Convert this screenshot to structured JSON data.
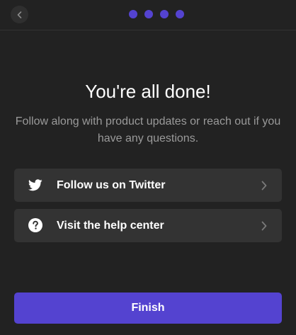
{
  "header": {
    "back_icon": "chevron-left-icon",
    "progress_steps_total": 4,
    "progress_steps_completed": 4,
    "accent_color": "#5443d0"
  },
  "main": {
    "title": "You're all done!",
    "subtitle": "Follow along with product updates or reach out if you have any questions."
  },
  "links": [
    {
      "label": "Follow us on Twitter",
      "icon": "twitter-icon"
    },
    {
      "label": "Visit the help center",
      "icon": "question-circle-icon"
    }
  ],
  "footer": {
    "finish_label": "Finish"
  },
  "colors": {
    "background": "#222222",
    "card": "#333333",
    "accent": "#5443d0",
    "muted_text": "#9a9a9a"
  }
}
